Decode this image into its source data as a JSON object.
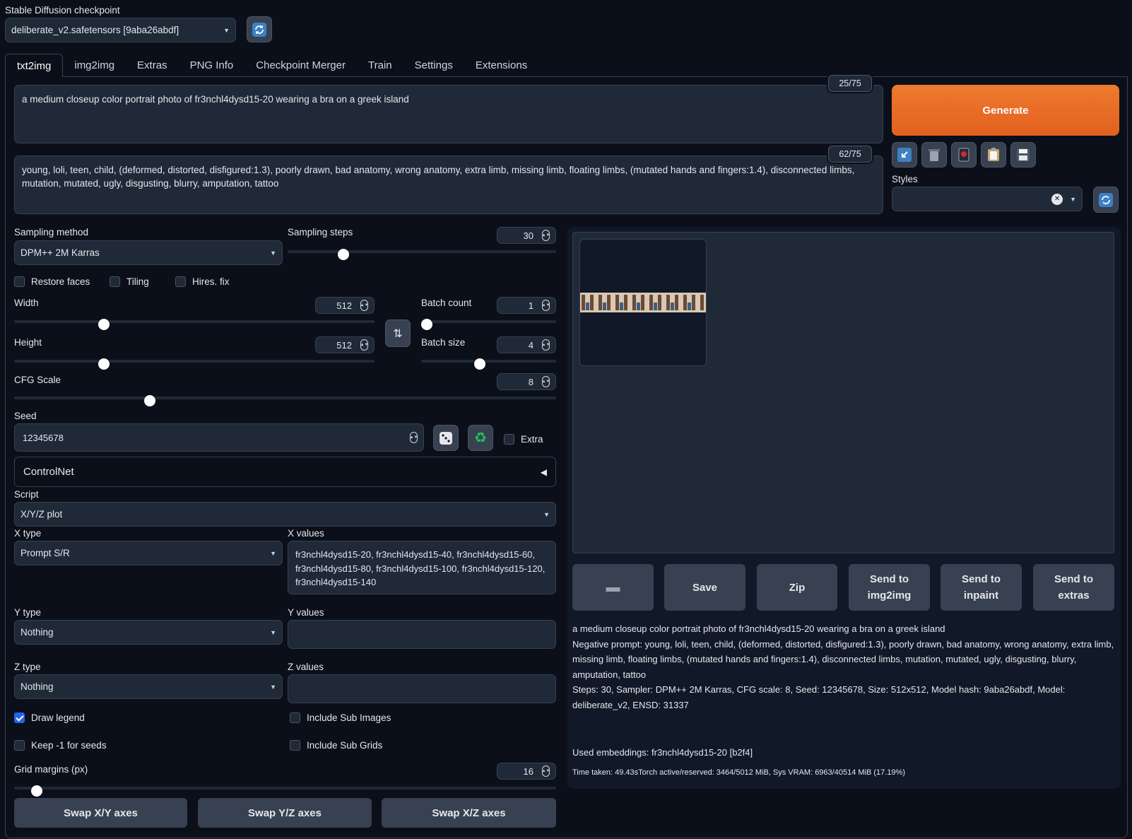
{
  "checkpoint": {
    "label": "Stable Diffusion checkpoint",
    "value": "deliberate_v2.safetensors [9aba26abdf]"
  },
  "tabs": [
    "txt2img",
    "img2img",
    "Extras",
    "PNG Info",
    "Checkpoint Merger",
    "Train",
    "Settings",
    "Extensions"
  ],
  "prompt": {
    "text": "a medium closeup color portrait photo of fr3nchl4dysd15-20 wearing a bra on a greek island",
    "counter": "25/75"
  },
  "negative": {
    "text": "young, loli, teen, child, (deformed, distorted, disfigured:1.3), poorly drawn, bad anatomy, wrong anatomy, extra limb, missing limb, floating limbs, (mutated hands and fingers:1.4), disconnected limbs, mutation, mutated, ugly, disgusting, blurry, amputation, tattoo",
    "counter": "62/75"
  },
  "generate_label": "Generate",
  "styles_label": "Styles",
  "sampling": {
    "method_label": "Sampling method",
    "method": "DPM++ 2M Karras",
    "steps_label": "Sampling steps",
    "steps": "30",
    "steps_level": 0.196
  },
  "checks": {
    "restore_faces": "Restore faces",
    "tiling": "Tiling",
    "hires": "Hires. fix"
  },
  "width": {
    "label": "Width",
    "value": "512",
    "level": 0.24
  },
  "height": {
    "label": "Height",
    "value": "512",
    "level": 0.24
  },
  "batch_count": {
    "label": "Batch count",
    "value": "1",
    "level": 0.0
  },
  "batch_size": {
    "label": "Batch size",
    "value": "4",
    "level": 0.43
  },
  "cfg": {
    "label": "CFG Scale",
    "value": "8",
    "level": 0.245
  },
  "seed": {
    "label": "Seed",
    "value": "12345678",
    "extra": "Extra"
  },
  "controlnet": "ControlNet",
  "script": {
    "label": "Script",
    "value": "X/Y/Z plot"
  },
  "x": {
    "type_label": "X type",
    "type": "Prompt S/R",
    "values_label": "X values",
    "values": "fr3nchl4dysd15-20, fr3nchl4dysd15-40, fr3nchl4dysd15-60, fr3nchl4dysd15-80, fr3nchl4dysd15-100, fr3nchl4dysd15-120, fr3nchl4dysd15-140"
  },
  "y": {
    "type_label": "Y type",
    "type": "Nothing",
    "values_label": "Y values",
    "values": ""
  },
  "z": {
    "type_label": "Z type",
    "type": "Nothing",
    "values_label": "Z values",
    "values": ""
  },
  "options": {
    "draw_legend": "Draw legend",
    "include_sub_images": "Include Sub Images",
    "keep_seeds": "Keep -1 for seeds",
    "include_sub_grids": "Include Sub Grids"
  },
  "grid_margins": {
    "label": "Grid margins (px)",
    "value": "16",
    "level": 0.032
  },
  "swap": [
    "Swap X/Y axes",
    "Swap Y/Z axes",
    "Swap X/Z axes"
  ],
  "output_buttons": {
    "save": "Save",
    "zip": "Zip",
    "img2img": "Send to img2img",
    "inpaint": "Send to inpaint",
    "extras": "Send to extras"
  },
  "info": {
    "prompt": "a medium closeup color portrait photo of fr3nchl4dysd15-20 wearing a bra on a greek island",
    "negative": "Negative prompt: young, loli, teen, child, (deformed, distorted, disfigured:1.3), poorly drawn, bad anatomy, wrong anatomy, extra limb, missing limb, floating limbs, (mutated hands and fingers:1.4), disconnected limbs, mutation, mutated, ugly, disgusting, blurry, amputation, tattoo",
    "params": "Steps: 30, Sampler: DPM++ 2M Karras, CFG scale: 8, Seed: 12345678, Size: 512x512, Model hash: 9aba26abdf, Model: deliberate_v2, ENSD: 31337",
    "embeddings": "Used embeddings: fr3nchl4dysd15-20 [b2f4]",
    "time": "Time taken: 49.43sTorch active/reserved: 3464/5012 MiB, Sys VRAM: 6963/40514 MiB (17.19%)"
  },
  "colors": {
    "generate": "#ea6d25",
    "bg": "#0b0f19",
    "accent": "#2563eb"
  }
}
